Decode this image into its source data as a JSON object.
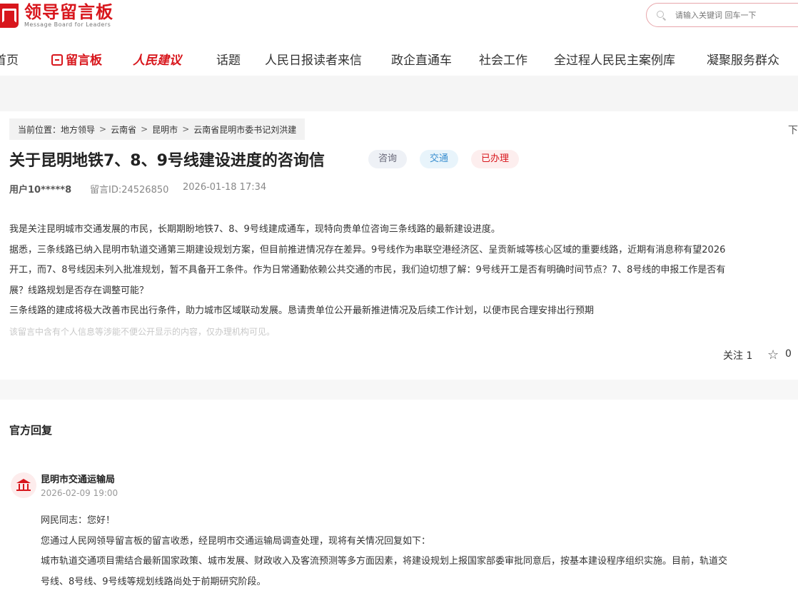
{
  "header": {
    "logo_cn": "领导留言板",
    "logo_en": "Message Board for Leaders",
    "search_placeholder": "请输入关键词 回车一下"
  },
  "nav": [
    {
      "label": "首页"
    },
    {
      "label": "留言板"
    },
    {
      "label": "人民建议"
    },
    {
      "label": "话题"
    },
    {
      "label": "人民日报读者来信"
    },
    {
      "label": "政企直通车"
    },
    {
      "label": "社会工作"
    },
    {
      "label": "全过程人民民主案例库"
    },
    {
      "label": "凝聚服务群众"
    }
  ],
  "breadcrumb": {
    "prefix": "当前位置：",
    "items": [
      "地方领导",
      "云南省",
      "昆明市",
      "云南省昆明市委书记刘洪建"
    ],
    "separator": ">",
    "right_partial": "下"
  },
  "message": {
    "title": "关于昆明地铁7、8、9号线建设进度的咨询信",
    "tags": [
      "咨询",
      "交通",
      "已办理"
    ],
    "user": "用户10*****8",
    "id_label": "留言ID:24526850",
    "time": "2026-01-18 17:34",
    "paragraphs": [
      "我是关注昆明城市交通发展的市民，长期期盼地铁7、8、9号线建成通车，现特向贵单位咨询三条线路的最新建设进度。",
      "据悉，三条线路已纳入昆明市轨道交通第三期建设规划方案，但目前推进情况存在差异。9号线作为串联空港经济区、呈贡新城等核心区域的重要线路，近期有消息称有望2026",
      "开工，而7、8号线因未列入批准规划，暂不具备开工条件。作为日常通勤依赖公共交通的市民，我们迫切想了解：9号线开工是否有明确时间节点？7、8号线的申报工作是否有",
      "展？线路规划是否存在调整可能？",
      "三条线路的建成将极大改善市民出行条件，助力城市区域联动发展。恳请贵单位公开最新推进情况及后续工作计划，以便市民合理安排出行预期"
    ],
    "notice": "该留言中含有个人信息等涉能不便公开显示的内容，仅办理机构可见。",
    "follow_label": "关注",
    "follow_count": "1",
    "like_count": "0"
  },
  "reply": {
    "section_title": "官方回复",
    "org": "昆明市交通运输局",
    "date": "2026-02-09 19:00",
    "paragraphs": [
      "网民同志：您好！",
      "您通过人民网领导留言板的留言收悉，经昆明市交通运输局调查处理，现将有关情况回复如下：",
      "城市轨道交通项目需结合最新国家政策、城市发展、财政收入及客流预测等多方面因素，将建设规划上报国家部委审批同意后，按基本建设程序组织实施。目前，轨道交",
      "号线、8号线、9号线等规划线路尚处于前期研究阶段。"
    ]
  },
  "colors": {
    "brand_red": "#d8161c",
    "traffic_blue": "#3b8fd0"
  },
  "icons": [
    "search-icon",
    "message-icon",
    "star-icon",
    "bank-icon"
  ]
}
